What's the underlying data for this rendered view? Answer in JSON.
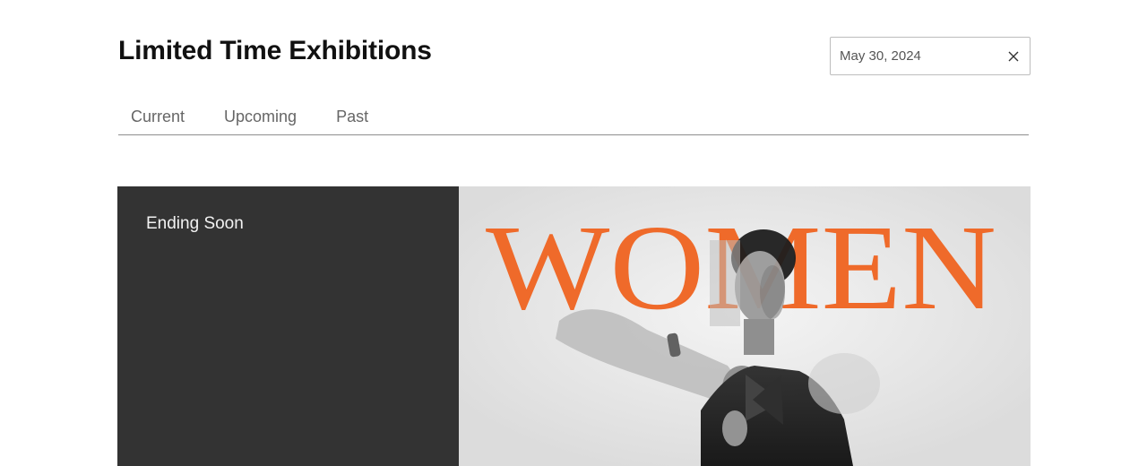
{
  "header": {
    "title": "Limited Time Exhibitions"
  },
  "date_filter": {
    "value": "May 30, 2024",
    "clear_icon": "close-icon"
  },
  "tabs": [
    {
      "label": "Current"
    },
    {
      "label": "Upcoming"
    },
    {
      "label": "Past"
    }
  ],
  "feature": {
    "label": "Ending Soon",
    "image_word": "WOMEN",
    "colors": {
      "panel": "#333333",
      "accent": "#ef6a2a",
      "image_bg": "#e6e6e6"
    }
  }
}
